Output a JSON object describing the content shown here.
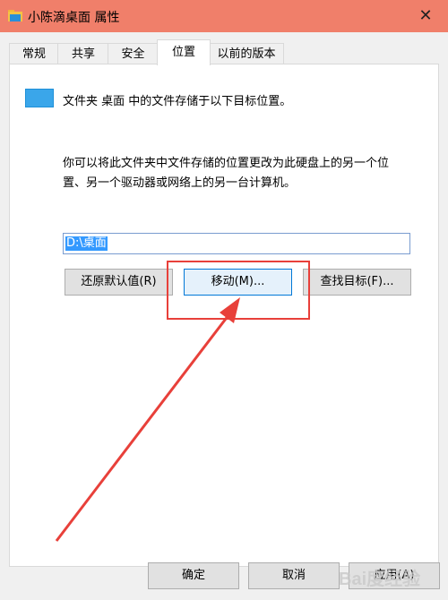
{
  "window": {
    "title": "小陈滴桌面 属性",
    "close_glyph": "✕"
  },
  "tabs": [
    {
      "label": "常规"
    },
    {
      "label": "共享"
    },
    {
      "label": "安全"
    },
    {
      "label": "位置",
      "active": true
    },
    {
      "label": "以前的版本"
    }
  ],
  "location": {
    "description": "文件夹 桌面 中的文件存储于以下目标位置。",
    "explanation": "你可以将此文件夹中文件存储的位置更改为此硬盘上的另一个位置、另一个驱动器或网络上的另一台计算机。",
    "path_value": "D:\\桌面",
    "restore_default_label": "还原默认值(R)",
    "move_label": "移动(M)...",
    "find_target_label": "查找目标(F)..."
  },
  "footer": {
    "ok_label": "确定",
    "cancel_label": "取消",
    "apply_label": "应用(A)"
  },
  "watermark": {
    "text": "Bai度经验"
  },
  "colors": {
    "titlebar": "#f07f6a",
    "annotation": "#e8403a",
    "accent": "#0078d7",
    "folder": "#1e90d8"
  }
}
